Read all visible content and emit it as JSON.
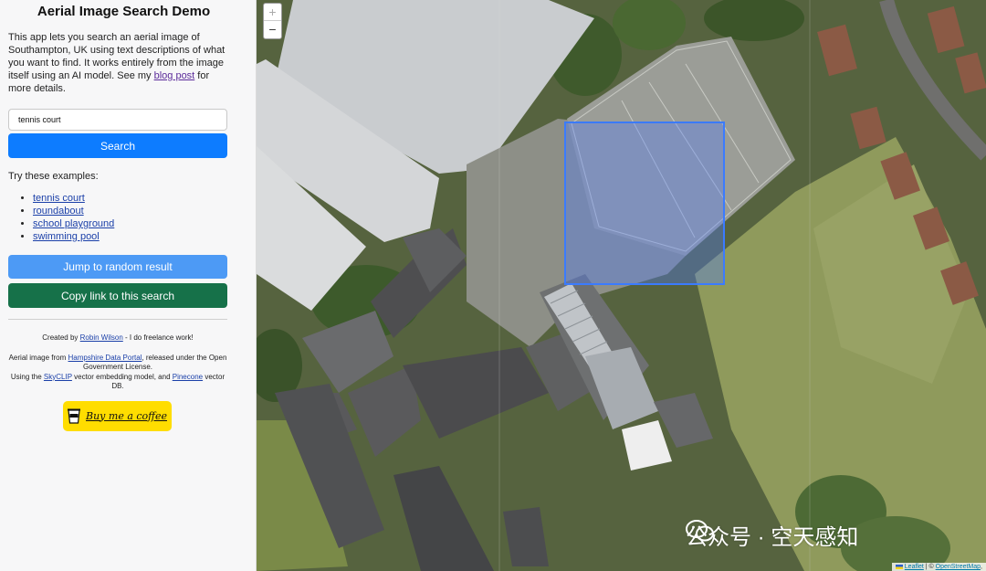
{
  "sidebar": {
    "title": "Aerial Image Search Demo",
    "intro_text": "This app lets you search an aerial image of Southampton, UK using text descriptions of what you want to find. It works entirely from the image itself using an AI model. See my ",
    "intro_link": "blog post",
    "intro_after": " for more details.",
    "search_value": "tennis court",
    "search_button": "Search",
    "examples_label": "Try these examples:",
    "examples": [
      "tennis court",
      "roundabout",
      "school playground",
      "swimming pool"
    ],
    "random_button": "Jump to random result",
    "copy_button": "Copy link to this search",
    "credit_prefix": "Created by ",
    "credit_author": "Robin Wilson",
    "credit_suffix": " - I do freelance work!",
    "aerial_prefix": "Aerial image from ",
    "aerial_source": "Hampshire Data Portal",
    "aerial_suffix": ", released under the Open Government License.",
    "using_prefix": "Using the ",
    "model_name": "SkyCLIP",
    "using_mid": " vector embedding model, and ",
    "db_name": "Pinecone",
    "using_suffix": " vector DB.",
    "coffee_label": "Buy me a coffee"
  },
  "map": {
    "zoom_in": "+",
    "zoom_out": "−",
    "attribution_leaflet": "Leaflet",
    "attribution_sep": " | © ",
    "attribution_osm": "OpenStreetMap",
    "attribution_end": ",",
    "watermark": "公众号 · 空天感知",
    "colors": {
      "selection_box": "#3b7bff",
      "search_button": "#0d7cff",
      "random_button": "#4d9af5",
      "copy_button": "#167149",
      "coffee_button": "#ffdd00"
    }
  }
}
